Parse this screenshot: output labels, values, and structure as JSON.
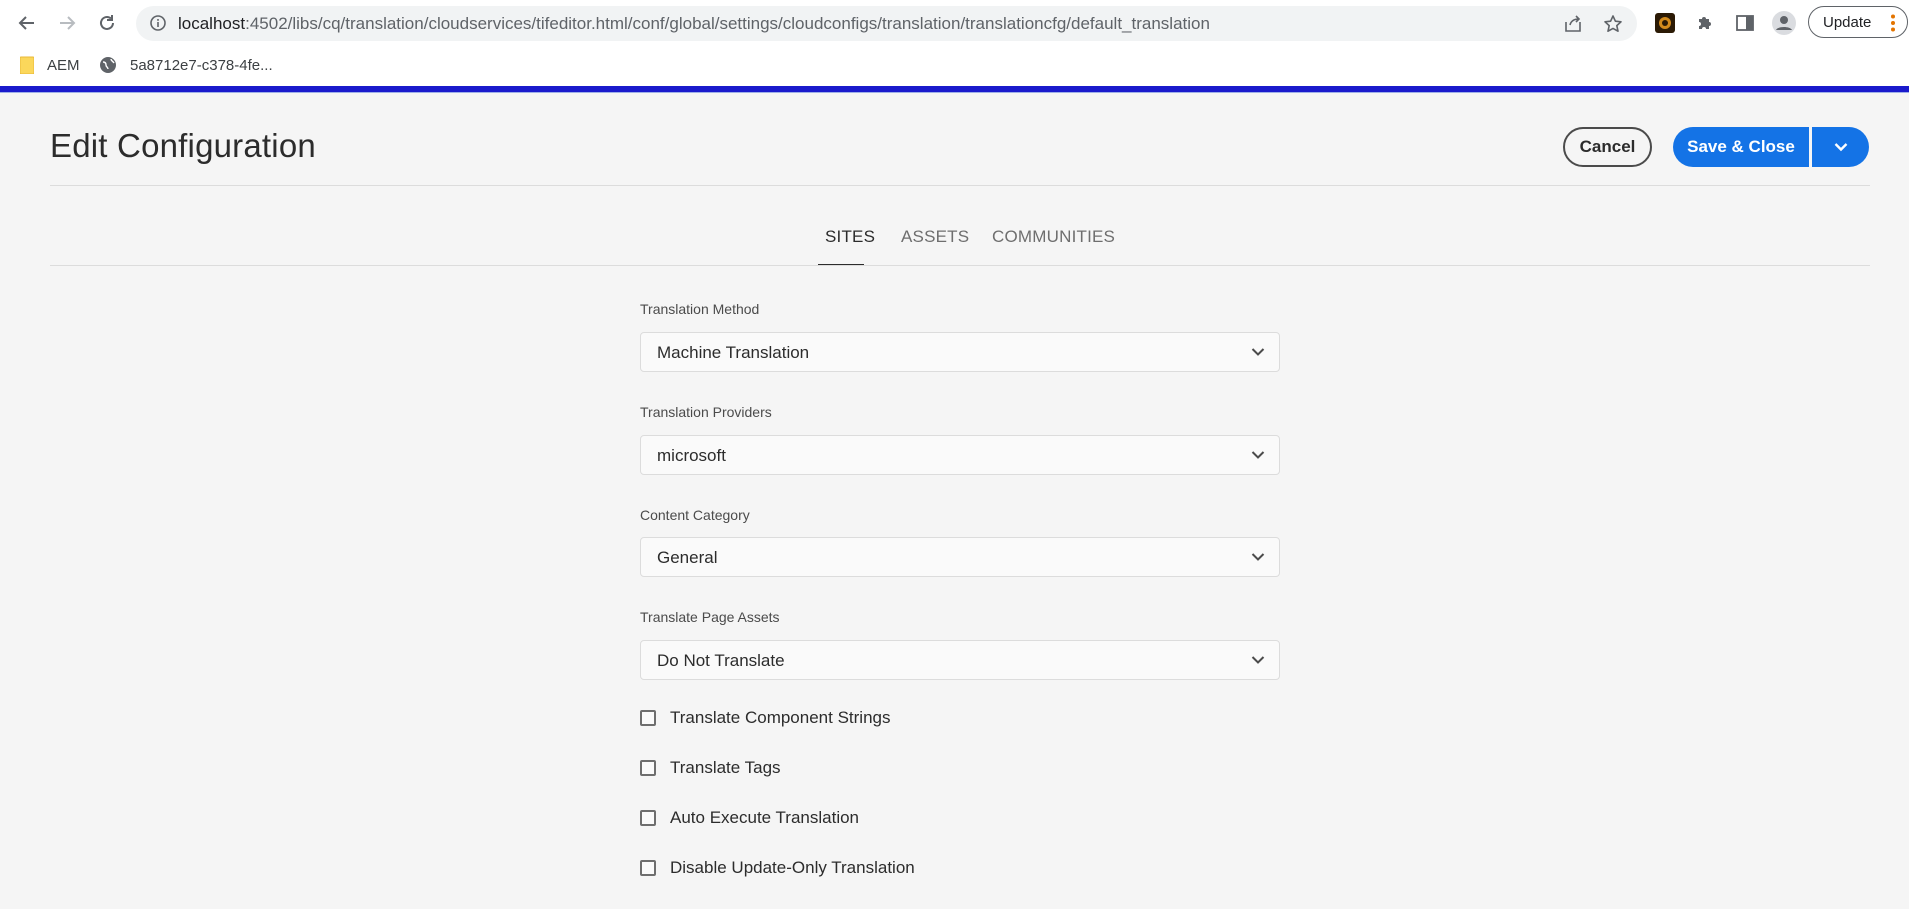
{
  "browser": {
    "url_host": "localhost",
    "url_rest": ":4502/libs/cq/translation/cloudservices/tifeditor.html/conf/global/settings/cloudconfigs/translation/translationcfg/default_translation",
    "update_label": "Update",
    "bookmarks": [
      {
        "label": "AEM",
        "icon": "folder-icon"
      },
      {
        "label": "5a8712e7-c378-4fe...",
        "icon": "globe-icon"
      }
    ],
    "accent_color": "#1a1acc"
  },
  "header": {
    "title": "Edit Configuration",
    "cancel_label": "Cancel",
    "save_label": "Save & Close",
    "primary_color": "#1473e6"
  },
  "tabs": [
    {
      "label": "SITES",
      "active": true
    },
    {
      "label": "ASSETS",
      "active": false
    },
    {
      "label": "COMMUNITIES",
      "active": false
    }
  ],
  "form": {
    "fields": [
      {
        "label": "Translation Method",
        "value": "Machine Translation"
      },
      {
        "label": "Translation Providers",
        "value": "microsoft"
      },
      {
        "label": "Content Category",
        "value": "General"
      },
      {
        "label": "Translate Page Assets",
        "value": "Do Not Translate"
      }
    ],
    "checkboxes": [
      {
        "label": "Translate Component Strings",
        "checked": false
      },
      {
        "label": "Translate Tags",
        "checked": false
      },
      {
        "label": "Auto Execute Translation",
        "checked": false
      },
      {
        "label": "Disable Update-Only Translation",
        "checked": false
      }
    ]
  }
}
